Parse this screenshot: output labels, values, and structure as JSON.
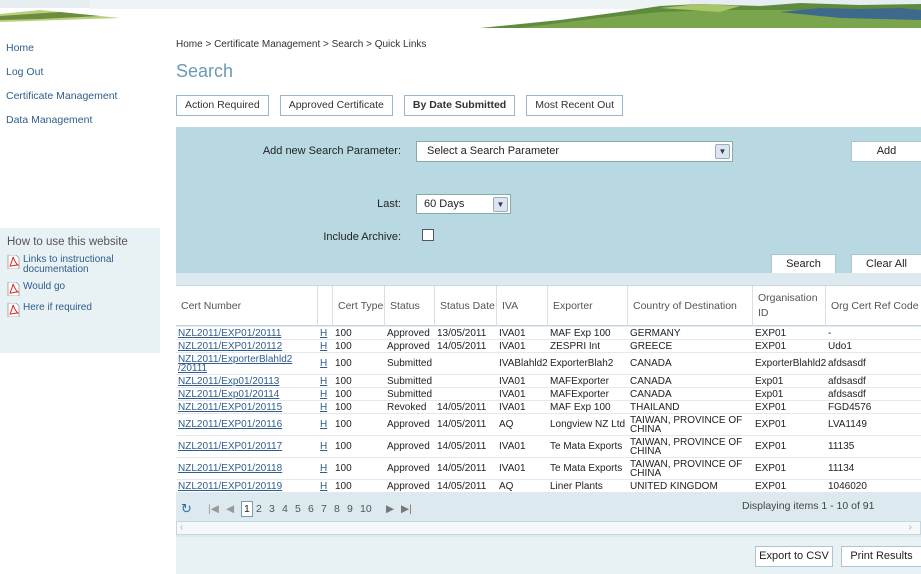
{
  "nav": {
    "items": [
      {
        "label": "Home"
      },
      {
        "label": "Log Out"
      },
      {
        "label": "Certificate Management"
      },
      {
        "label": "Data Management"
      }
    ]
  },
  "help": {
    "title": "How to use this website",
    "links": [
      {
        "label": "Links to instructional documentation",
        "icon": "pdf-icon"
      },
      {
        "label": "Would go",
        "icon": "pdf-icon"
      },
      {
        "label": "Here if required",
        "icon": "pdf-icon"
      }
    ]
  },
  "breadcrumb": "Home > Certificate Management > Search > Quick Links",
  "page_title": "Search",
  "tabs": [
    {
      "label": "Action Required",
      "active": false
    },
    {
      "label": "Approved Certificate",
      "active": false
    },
    {
      "label": "By Date Submitted",
      "active": true
    },
    {
      "label": "Most Recent Out",
      "active": false
    }
  ],
  "search": {
    "add_param_label": "Add new Search Parameter:",
    "param_placeholder": "Select a Search Parameter",
    "add_button": "Add",
    "last_label": "Last:",
    "last_value": "60 Days",
    "archive_label": "Include Archive:",
    "archive_checked": false,
    "search_button": "Search",
    "clear_button": "Clear All"
  },
  "grid": {
    "columns": [
      "Cert Number",
      "",
      "Cert Type",
      "Status",
      "Status Date",
      "IVA",
      "Exporter",
      "Country of Destination",
      "Organisation ID",
      "Org Cert Ref Code"
    ],
    "rows": [
      {
        "cert": "NZL2011/EXP01/20111",
        "h": "H",
        "type": "100",
        "status": "Approved",
        "date": "13/05/2011",
        "iva": "IVA01",
        "exporter": "MAF Exp 100",
        "country": "GERMANY",
        "org": "EXP01",
        "ref": "-"
      },
      {
        "cert": "NZL2011/EXP01/20112",
        "h": "H",
        "type": "100",
        "status": "Approved",
        "date": "14/05/2011",
        "iva": "IVA01",
        "exporter": "ZESPRI Int",
        "country": "GREECE",
        "org": "EXP01",
        "ref": "Udo1"
      },
      {
        "cert": "NZL2011/ExporterBlahld2 /20111",
        "h": "H",
        "type": "100",
        "status": "Submitted",
        "date": "",
        "iva": "IVABlahld2",
        "exporter": "ExporterBlah2",
        "country": "CANADA",
        "org": "ExporterBlahld2",
        "ref": "afdsasdf"
      },
      {
        "cert": "NZL2011/Exp01/20113",
        "h": "H",
        "type": "100",
        "status": "Submitted",
        "date": "",
        "iva": "IVA01",
        "exporter": "MAFExporter",
        "country": "CANADA",
        "org": "Exp01",
        "ref": "afdsasdf"
      },
      {
        "cert": "NZL2011/Exp01/20114",
        "h": "H",
        "type": "100",
        "status": "Submitted",
        "date": "",
        "iva": "IVA01",
        "exporter": "MAFExporter",
        "country": "CANADA",
        "org": "Exp01",
        "ref": "afdsasdf"
      },
      {
        "cert": "NZL2011/EXP01/20115",
        "h": "H",
        "type": "100",
        "status": "Revoked",
        "date": "14/05/2011",
        "iva": "IVA01",
        "exporter": "MAF Exp 100",
        "country": "THAILAND",
        "org": "EXP01",
        "ref": "FGD4576"
      },
      {
        "cert": "NZL2011/EXP01/20116",
        "h": "H",
        "type": "100",
        "status": "Approved",
        "date": "14/05/2011",
        "iva": "AQ",
        "exporter": "Longview NZ Ltd",
        "country": "TAIWAN, PROVINCE OF CHINA",
        "org": "EXP01",
        "ref": "LVA1149"
      },
      {
        "cert": "NZL2011/EXP01/20117",
        "h": "H",
        "type": "100",
        "status": "Approved",
        "date": "14/05/2011",
        "iva": "IVA01",
        "exporter": "Te Mata Exports",
        "country": "TAIWAN, PROVINCE OF CHINA",
        "org": "EXP01",
        "ref": "11135"
      },
      {
        "cert": "NZL2011/EXP01/20118",
        "h": "H",
        "type": "100",
        "status": "Approved",
        "date": "14/05/2011",
        "iva": "IVA01",
        "exporter": "Te Mata Exports",
        "country": "TAIWAN, PROVINCE OF CHINA",
        "org": "EXP01",
        "ref": "11134"
      },
      {
        "cert": "NZL2011/EXP01/20119",
        "h": "H",
        "type": "100",
        "status": "Approved",
        "date": "14/05/2011",
        "iva": "AQ",
        "exporter": "Liner Plants",
        "country": "UNITED KINGDOM",
        "org": "EXP01",
        "ref": "1046020"
      }
    ]
  },
  "pager": {
    "pages": [
      "1",
      "2",
      "3",
      "4",
      "5",
      "6",
      "7",
      "8",
      "9",
      "10"
    ],
    "current": "1",
    "display": "Displaying items 1 - 10 of 91",
    "first_icon": "first-page-icon",
    "prev_icon": "prev-page-icon",
    "next_icon": "next-page-icon",
    "last_icon": "last-page-icon",
    "refresh_icon": "refresh-icon"
  },
  "actions": {
    "export": "Export to CSV",
    "print": "Print Results"
  },
  "colors": {
    "panel": "#b9d9e2",
    "link": "#2e5d8e",
    "title": "#6a9ab5"
  }
}
